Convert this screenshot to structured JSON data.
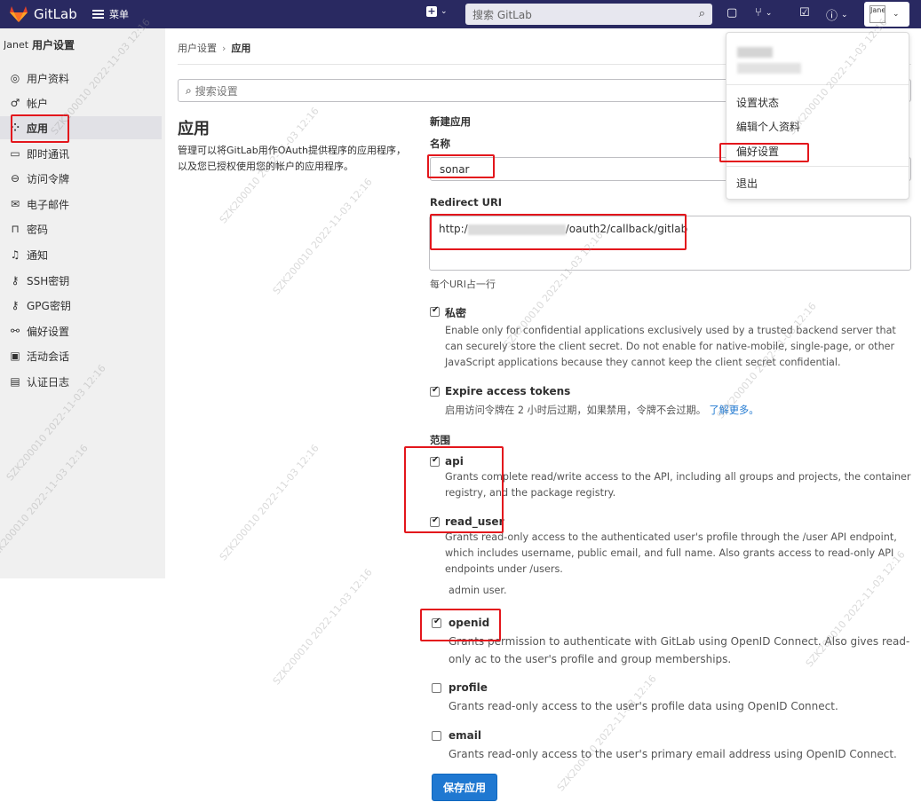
{
  "topbar": {
    "brand": "GitLab",
    "menu_label": "菜单",
    "search_placeholder": "搜索 GitLab",
    "avatar_alt": "Janet",
    "colors": {
      "bg": "#292961",
      "logo": "#e24329"
    }
  },
  "sidebar": {
    "user_alt": "Janet",
    "title": "用户设置",
    "items": [
      {
        "label": "用户资料",
        "icon": "user-circle-icon"
      },
      {
        "label": "帐户",
        "icon": "account-icon"
      },
      {
        "label": "应用",
        "icon": "applications-icon",
        "active": true
      },
      {
        "label": "即时通讯",
        "icon": "chat-icon"
      },
      {
        "label": "访问令牌",
        "icon": "token-icon"
      },
      {
        "label": "电子邮件",
        "icon": "mail-icon"
      },
      {
        "label": "密码",
        "icon": "lock-icon"
      },
      {
        "label": "通知",
        "icon": "bell-icon"
      },
      {
        "label": "SSH密钥",
        "icon": "key-icon"
      },
      {
        "label": "GPG密钥",
        "icon": "key-icon"
      },
      {
        "label": "偏好设置",
        "icon": "preferences-icon"
      },
      {
        "label": "活动会话",
        "icon": "monitor-icon"
      },
      {
        "label": "认证日志",
        "icon": "log-icon"
      }
    ]
  },
  "breadcrumb": {
    "parent": "用户设置",
    "sep": "›",
    "current": "应用"
  },
  "settings_search_placeholder": "搜索设置",
  "section": {
    "title": "应用",
    "description": "管理可以将GitLab用作OAuth提供程序的应用程序，以及您已授权使用您的帐户的应用程序。"
  },
  "form": {
    "heading": "新建应用",
    "name_label": "名称",
    "name_value": "sonar",
    "redirect_label": "Redirect URI",
    "redirect_prefix": "http:/",
    "redirect_suffix": "/oauth2/callback/gitlab",
    "redirect_hint": "每个URI占一行",
    "confidential": {
      "label": "私密",
      "checked": true,
      "desc": "Enable only for confidential applications exclusively used by a trusted backend server that can securely store the client secret. Do not enable for native-mobile, single-page, or other JavaScript applications because they cannot keep the client secret confidential."
    },
    "expire": {
      "label": "Expire access tokens",
      "checked": true,
      "desc": "启用访问令牌在 2 小时后过期，如果禁用，令牌不会过期。",
      "link": "了解更多。"
    },
    "scopes_label": "范围",
    "scopes": [
      {
        "name": "api",
        "checked": true,
        "desc": "Grants complete read/write access to the API, including all groups and projects, the container registry, and the package registry."
      },
      {
        "name": "read_user",
        "checked": true,
        "desc": "Grants read-only access to the authenticated user's profile through the /user API endpoint, which includes username, public email, and full name. Also grants access to read-only API endpoints under /users."
      },
      {
        "name": "openid",
        "checked": true,
        "desc": "Grants permission to authenticate with GitLab using OpenID Connect. Also gives read-only ac to the user's profile and group memberships."
      },
      {
        "name": "profile",
        "checked": false,
        "desc": "Grants read-only access to the user's profile data using OpenID Connect."
      },
      {
        "name": "email",
        "checked": false,
        "desc": "Grants read-only access to the user's primary email address using OpenID Connect."
      }
    ],
    "partial_line": "admin user.",
    "save_label": "保存应用"
  },
  "user_dropdown": {
    "items": [
      "设置状态",
      "编辑个人资料",
      "偏好设置",
      "退出"
    ]
  },
  "watermark": "SZK200010 2022-11-03 12:16"
}
